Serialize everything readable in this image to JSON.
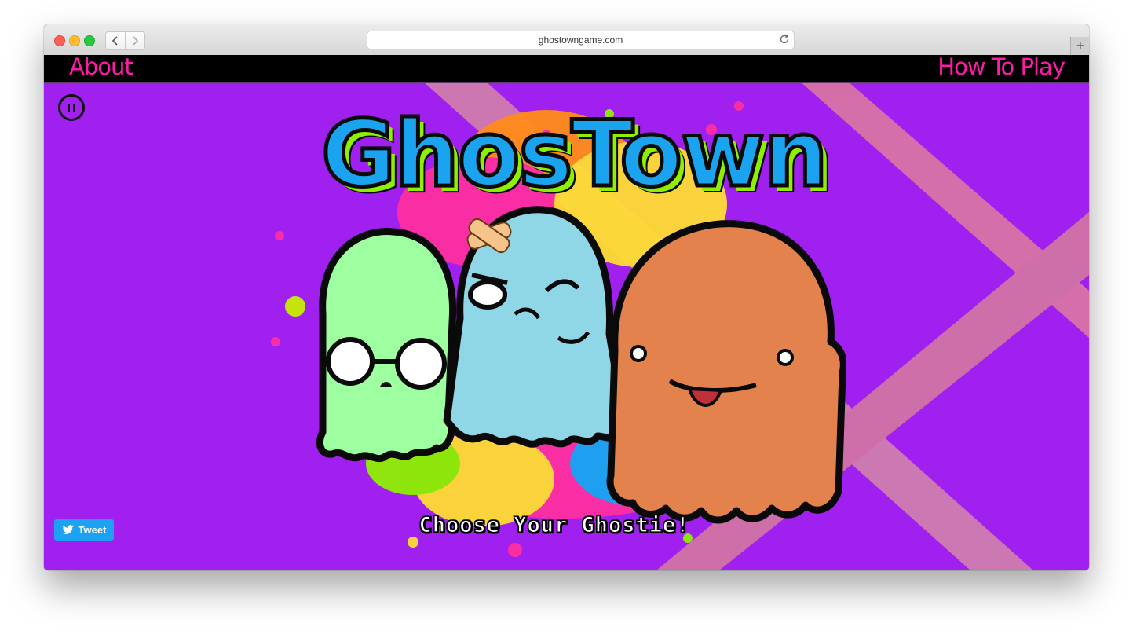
{
  "browser": {
    "url": "ghostowngame.com",
    "new_tab_symbol": "+"
  },
  "nav": {
    "about_label": "About",
    "how_to_play_label": "How To Play"
  },
  "game": {
    "title": "GhosTown",
    "prompt": "Choose Your Ghostie!",
    "ghosts": [
      {
        "name": "green-ghost",
        "color": "#9dffa0"
      },
      {
        "name": "blue-ghost",
        "color": "#8fd6e6"
      },
      {
        "name": "orange-ghost",
        "color": "#e4824e"
      }
    ]
  },
  "social": {
    "tweet_label": "Tweet"
  },
  "colors": {
    "background": "#a020f0",
    "nav_link": "#ff1aa8",
    "title_fill": "#1aa3ef",
    "title_shadow": "#8ef000",
    "tweet_button": "#1da1f2"
  },
  "icons": {
    "pause": "pause-icon",
    "twitter": "twitter-bird-icon",
    "back": "chevron-left-icon",
    "forward": "chevron-right-icon",
    "reload": "reload-icon"
  }
}
